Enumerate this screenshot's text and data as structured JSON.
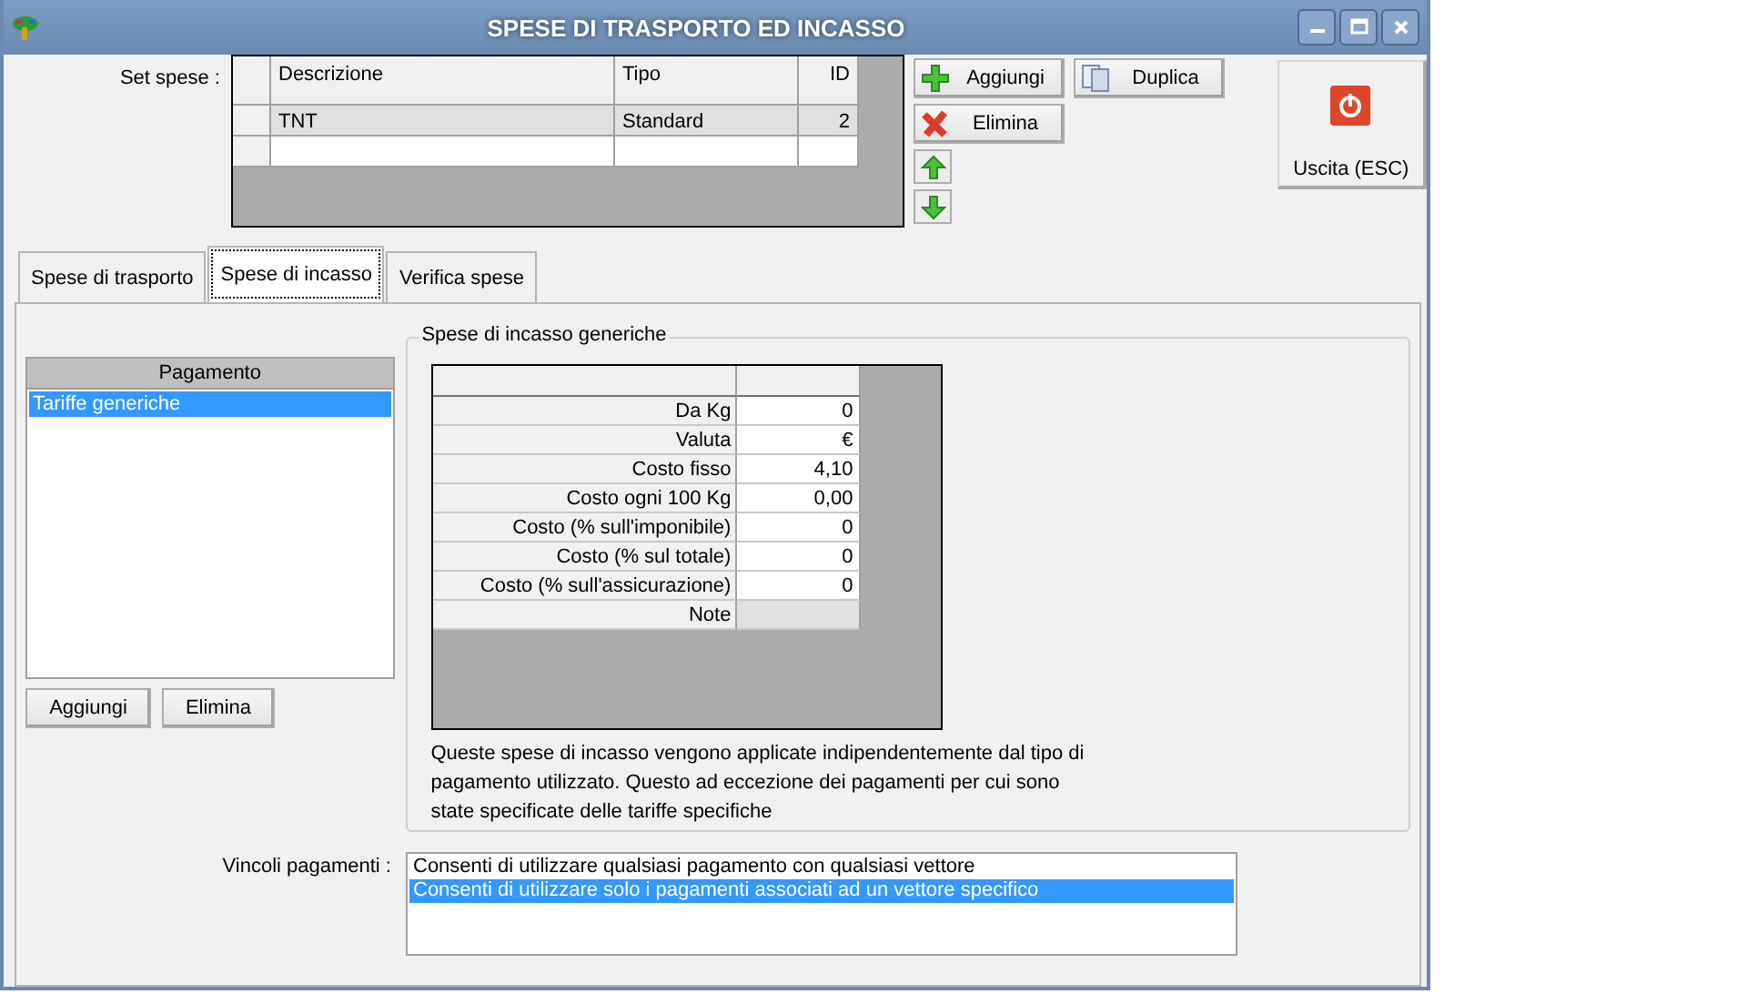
{
  "window": {
    "title": "SPESE DI TRASPORTO ED INCASSO"
  },
  "set_spese": {
    "label": "Set spese :",
    "columns": [
      "Descrizione",
      "Tipo",
      "ID"
    ],
    "rows": [
      {
        "cells": [
          "TNT",
          "Standard",
          "2"
        ],
        "selected": true
      }
    ]
  },
  "actions": {
    "add": "Aggiungi",
    "duplicate": "Duplica",
    "delete": "Elimina",
    "exit": "Uscita (ESC)"
  },
  "tabs": [
    {
      "label": "Spese di trasporto",
      "selected": false
    },
    {
      "label": "Spese di incasso",
      "selected": true
    },
    {
      "label": "Verifica spese",
      "selected": false
    }
  ],
  "pagamento": {
    "header": "Pagamento",
    "items": [
      {
        "label": "Tariffe generiche",
        "selected": true
      }
    ],
    "buttons": [
      "Aggiungi",
      "Elimina"
    ]
  },
  "generic_fees": {
    "title": "Spese di incasso generiche",
    "rows": [
      {
        "label": "Da Kg",
        "value": "0"
      },
      {
        "label": "Valuta",
        "value": "€"
      },
      {
        "label": "Costo fisso",
        "value": "4,10"
      },
      {
        "label": "Costo ogni 100 Kg",
        "value": "0,00"
      },
      {
        "label": "Costo (% sull'imponibile)",
        "value": "0"
      },
      {
        "label": "Costo (% sul totale)",
        "value": "0"
      },
      {
        "label": "Costo (% sull'assicurazione)",
        "value": "0"
      },
      {
        "label": "Note"
      }
    ],
    "description": "Queste spese di incasso vengono applicate indipendentemente dal tipo di pagamento utilizzato. Questo ad eccezione dei pagamenti per cui sono state specificate delle tariffe specifiche"
  },
  "vincoli": {
    "label": "Vincoli pagamenti :",
    "options": [
      {
        "label": "Consenti di utilizzare qualsiasi pagamento con qualsiasi vettore",
        "selected": false
      },
      {
        "label": "Consenti di utilizzare solo i pagamenti associati ad un vettore specifico",
        "selected": true
      }
    ]
  }
}
